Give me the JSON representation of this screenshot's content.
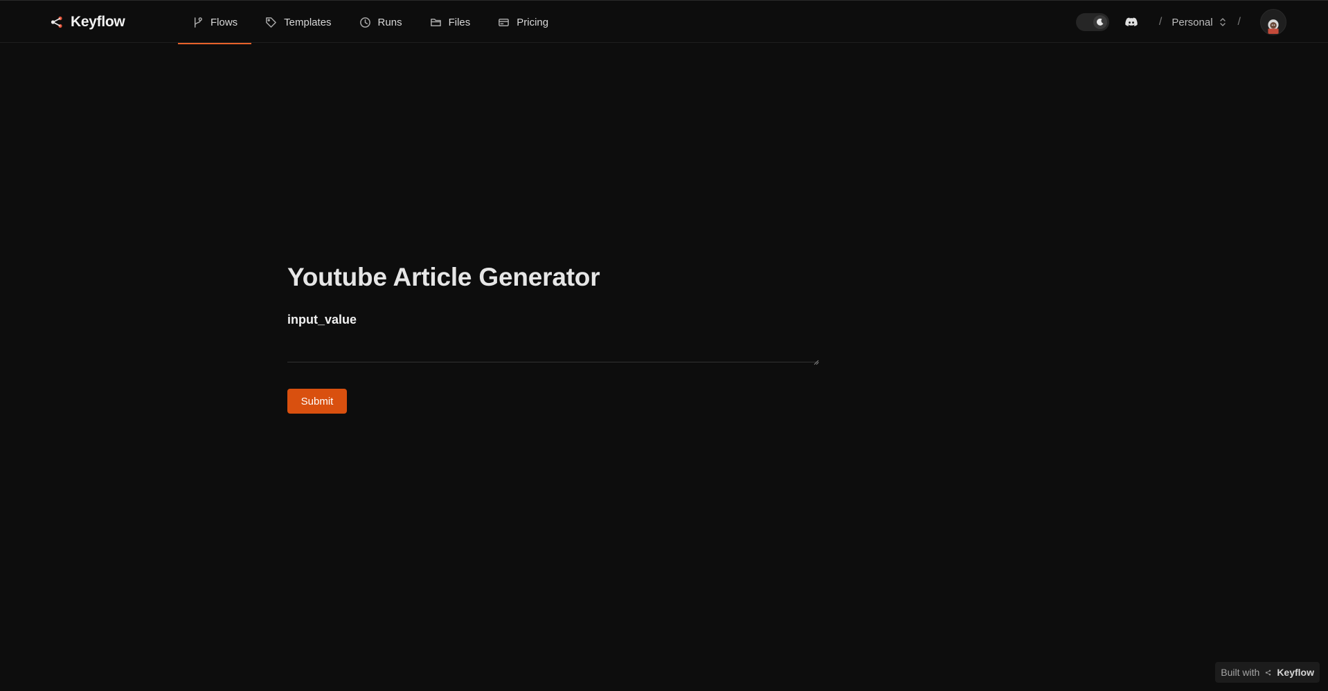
{
  "brand": {
    "name": "Keyflow",
    "icon": "share-nodes-icon",
    "accent_color": "#e8622a"
  },
  "nav": {
    "items": [
      {
        "label": "Flows",
        "icon": "branch-icon",
        "active": true
      },
      {
        "label": "Templates",
        "icon": "tag-icon",
        "active": false
      },
      {
        "label": "Runs",
        "icon": "clock-icon",
        "active": false
      },
      {
        "label": "Files",
        "icon": "folder-icon",
        "active": false
      },
      {
        "label": "Pricing",
        "icon": "credit-card-icon",
        "active": false
      }
    ]
  },
  "header_right": {
    "theme_toggle": {
      "icon": "moon-icon",
      "state": "dark"
    },
    "discord_icon": "discord-icon",
    "separator": "/",
    "workspace_label": "Personal",
    "workspace_icon": "chevrons-up-down-icon",
    "avatar_icon": "user-avatar"
  },
  "form": {
    "title": "Youtube Article Generator",
    "field_label": "input_value",
    "field_value": "",
    "submit_label": "Submit",
    "submit_color": "#d9500f"
  },
  "footer": {
    "built_with": "Built with",
    "brand": "Keyflow"
  }
}
